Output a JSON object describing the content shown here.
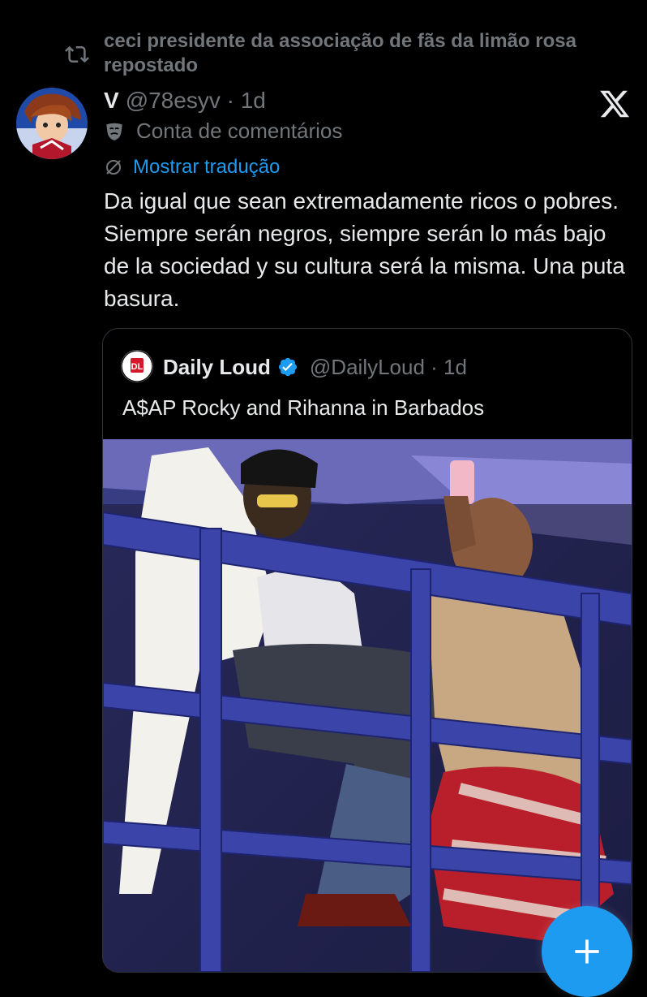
{
  "repost": {
    "text": "ceci presidente da associação de fãs da limão rosa repostado",
    "icon": "repost-icon"
  },
  "tweet": {
    "name": "V",
    "handle_time": "@78esyv · 1d",
    "label": "Conta de comentários",
    "translate": "Mostrar tradução",
    "text": "Da igual que sean extremadamente ricos o pobres. Siempre serán negros, siempre serán lo más bajo de la sociedad y su cultura será la misma. Una puta basura."
  },
  "quote": {
    "name": "Daily Loud",
    "handle_time": "@DailyLoud · 1d",
    "text": "A$AP Rocky and Rihanna in Barbados",
    "verified": true
  },
  "fab": {
    "label": "+"
  },
  "colors": {
    "background": "#000000",
    "text": "#e7e9ea",
    "muted": "#71767b",
    "accent": "#1d9bf0"
  }
}
